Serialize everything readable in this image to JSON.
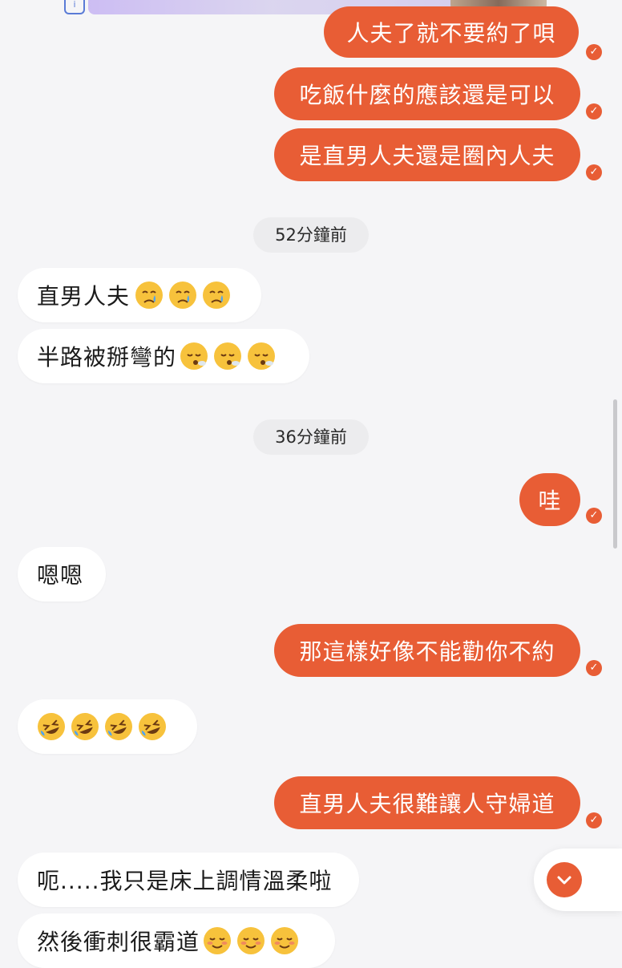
{
  "messages": {
    "m1": "人夫了就不要約了唄",
    "m2": "吃飯什麼的應該還是可以",
    "m3": "是直男人夫還是圈內人夫",
    "time1": "52分鐘前",
    "m4": "直男人夫",
    "m5": "半路被掰彎的",
    "time2": "36分鐘前",
    "m6": "哇",
    "m7": "嗯嗯",
    "m8": "那這樣好像不能勸你不約",
    "m10": "直男人夫很難讓人守婦道",
    "m11": "呃.....我只是床上調情溫柔啦",
    "m12": "然後衝刺很霸道"
  },
  "icons": {
    "sent": "check-icon",
    "scroll_down": "chevron-down-icon",
    "info": "info-icon"
  },
  "colors": {
    "accent": "#e85d35",
    "background": "#f5f5f7",
    "incoming_bubble": "#ffffff"
  }
}
